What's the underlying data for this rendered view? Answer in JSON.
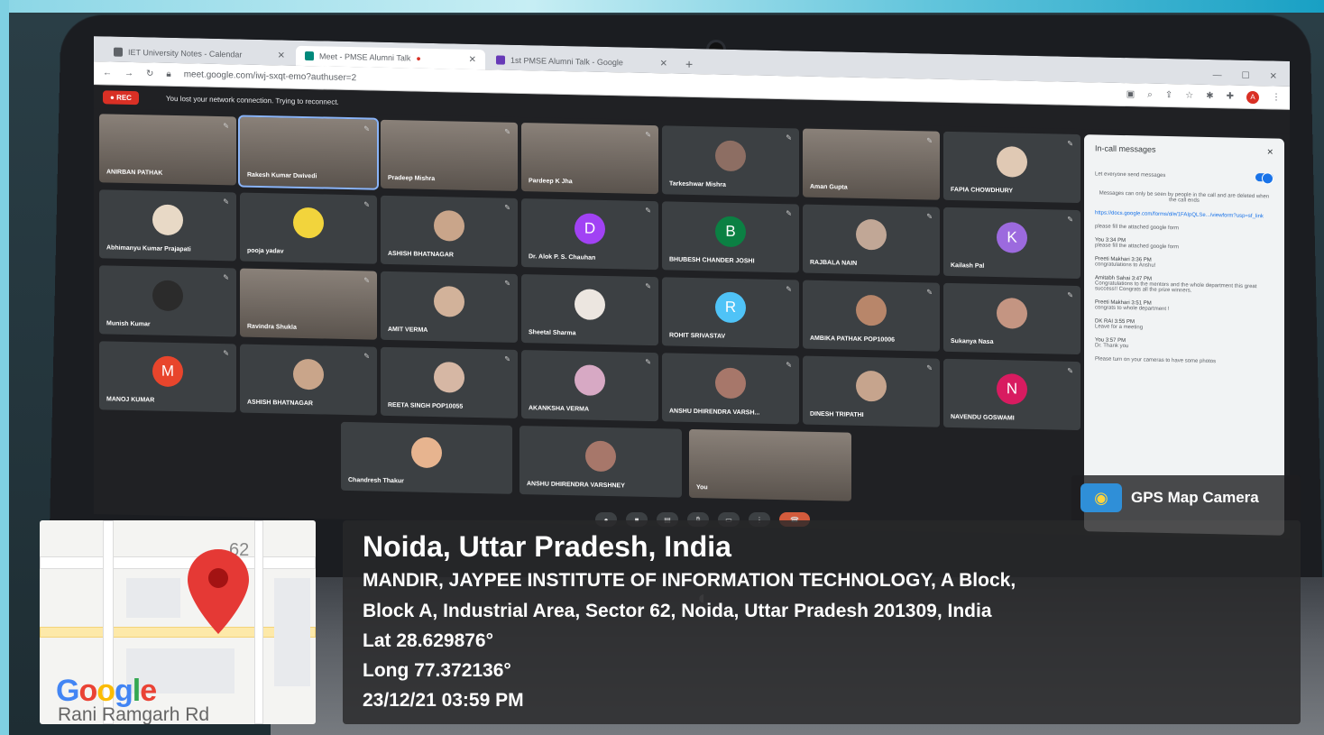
{
  "browser": {
    "tabs": [
      {
        "label": "IET University Notes - Calendar",
        "active": false,
        "favicon_color": "#5f6368"
      },
      {
        "label": "Meet - PMSE Alumni Talk",
        "active": true,
        "favicon_color": "#00897b"
      },
      {
        "label": "1st PMSE Alumni Talk - Google",
        "active": false,
        "favicon_color": "#673ab7"
      }
    ],
    "new_tab_icon": "plus-icon",
    "url": "meet.google.com/iwj-sxqt-emo?authuser=2"
  },
  "meet": {
    "rec_label": "REC",
    "network_message": "You lost your network connection. Trying to reconnect.",
    "participants_row1": [
      {
        "name": "ANIRBAN PATHAK",
        "type": "video"
      },
      {
        "name": "Rakesh Kumar Dwivedi",
        "type": "video",
        "highlight": true
      },
      {
        "name": "Pradeep Mishra",
        "type": "video"
      },
      {
        "name": "Pardeep K Jha",
        "type": "video"
      },
      {
        "name": "Tarkeshwar Mishra",
        "type": "avatar",
        "color": "#8d6e63",
        "letter": ""
      },
      {
        "name": "Aman Gupta",
        "type": "video"
      },
      {
        "name": "FAPIA CHOWDHURY",
        "type": "avatar",
        "color": "#e0c9b4",
        "letter": ""
      }
    ],
    "participants_row2": [
      {
        "name": "Abhimanyu Kumar Prajapati",
        "type": "avatar",
        "color": "#e8d9c6",
        "letter": ""
      },
      {
        "name": "pooja yadav",
        "type": "avatar",
        "color": "#f2d43c",
        "letter": ""
      },
      {
        "name": "ASHISH BHATNAGAR",
        "type": "avatar",
        "color": "#c9a58a",
        "letter": ""
      },
      {
        "name": "Dr. Alok P. S. Chauhan",
        "type": "avatar",
        "color": "#a142f4",
        "letter": "D"
      },
      {
        "name": "BHUBESH CHANDER JOSHI",
        "type": "avatar",
        "color": "#0b8043",
        "letter": "B"
      },
      {
        "name": "RAJBALA NAIN",
        "type": "avatar",
        "color": "#c1a796",
        "letter": ""
      },
      {
        "name": "Kailash Pal",
        "type": "avatar",
        "color": "#9c6ade",
        "letter": "K"
      }
    ],
    "participants_row3": [
      {
        "name": "Munish Kumar",
        "type": "avatar",
        "color": "#2b2b2b",
        "letter": ""
      },
      {
        "name": "Ravindra Shukla",
        "type": "video"
      },
      {
        "name": "AMIT VERMA",
        "type": "avatar",
        "color": "#d2b29a",
        "letter": ""
      },
      {
        "name": "Sheetal Sharma",
        "type": "avatar",
        "color": "#ece6e0",
        "letter": ""
      },
      {
        "name": "ROHIT SRIVASTAV",
        "type": "avatar",
        "color": "#4fc3f7",
        "letter": "R"
      },
      {
        "name": "AMBIKA PATHAK POP10006",
        "type": "avatar",
        "color": "#b8866a",
        "letter": ""
      },
      {
        "name": "Sukanya Nasa",
        "type": "avatar",
        "color": "#c49582",
        "letter": ""
      }
    ],
    "participants_row4": [
      {
        "name": "MANOJ KUMAR",
        "type": "avatar",
        "color": "#e8452c",
        "letter": "M"
      },
      {
        "name": "ASHISH BHATNAGAR",
        "type": "avatar",
        "color": "#c9a58a",
        "letter": ""
      },
      {
        "name": "REETA SINGH POP10055",
        "type": "avatar",
        "color": "#d6b7a4",
        "letter": ""
      },
      {
        "name": "AKANKSHA VERMA",
        "type": "avatar",
        "color": "#d7a9c4",
        "letter": ""
      },
      {
        "name": "ANSHU DHIRENDRA VARSH...",
        "type": "avatar",
        "color": "#a7776a",
        "letter": ""
      },
      {
        "name": "DINESH TRIPATHI",
        "type": "avatar",
        "color": "#c6a48d",
        "letter": ""
      },
      {
        "name": "NAVENDU GOSWAMI",
        "type": "avatar",
        "color": "#d81b60",
        "letter": "N"
      }
    ],
    "participants_row5": [
      {
        "name": "Chandresh Thakur",
        "type": "avatar",
        "color": "#e7b48f",
        "letter": ""
      },
      {
        "name": "ANSHU DHIRENDRA VARSHNEY",
        "type": "avatar",
        "color": "#a7776a",
        "letter": ""
      },
      {
        "name": "You",
        "type": "video"
      }
    ],
    "chat": {
      "title": "In-call messages",
      "toggle_label": "Let everyone send messages",
      "note": "Messages can only be seen by people in the call and are deleted when the call ends",
      "link": "https://docs.google.com/forms/d/e/1FAIpQLSe.../viewform?usp=sf_link",
      "messages": [
        {
          "who": "",
          "text": "please fill the attached google form"
        },
        {
          "who": "You 3:34 PM",
          "text": "please fill the attached google form"
        },
        {
          "who": "Preeti Makhari 3:36 PM",
          "text": "congratulations to Anshu!"
        },
        {
          "who": "Amitabh Sahai 3:47 PM",
          "text": "Congratulations to the mentors and the whole department this great success!! Congrats all the prize winners."
        },
        {
          "who": "Preeti Makhari 3:51 PM",
          "text": "congrats to whole department !"
        },
        {
          "who": "DK RAI 3:55 PM",
          "text": "Leave for a meeting"
        },
        {
          "who": "You 3:57 PM",
          "text": "Dr. Thank you"
        },
        {
          "who": "",
          "text": "Please turn on your cameras to have some photos"
        }
      ]
    }
  },
  "gps": {
    "brand": "GPS Map Camera",
    "city": "Noida, Uttar Pradesh, India",
    "line1": "MANDIR, JAYPEE INSTITUTE OF INFORMATION TECHNOLOGY, A Block,",
    "line2": "Block A, Industrial Area, Sector 62, Noida, Uttar Pradesh 201309, India",
    "lat": "Lat 28.629876°",
    "long": "Long 77.372136°",
    "datetime": "23/12/21 03:59 PM",
    "map": {
      "number_label": "62",
      "logo": "Google",
      "street": "Rani Ramgarh Rd",
      "pin_color": "#e53935"
    }
  }
}
